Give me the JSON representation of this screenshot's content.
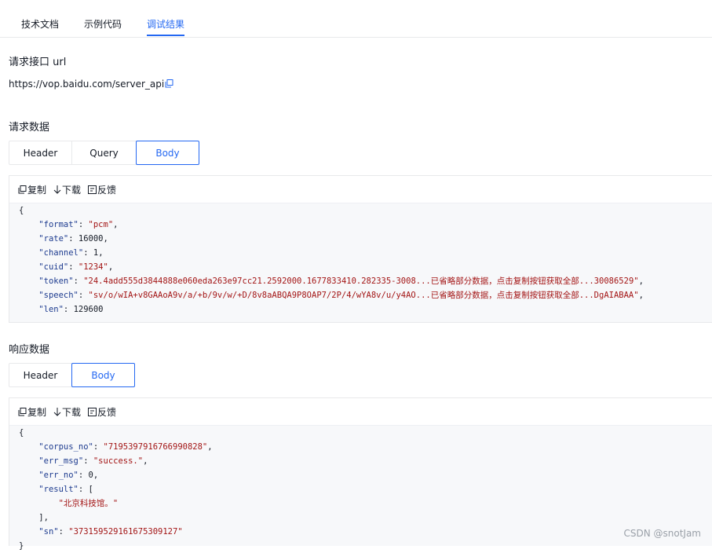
{
  "tabs": [
    {
      "label": "技术文档",
      "active": false
    },
    {
      "label": "示例代码",
      "active": false
    },
    {
      "label": "调试结果",
      "active": true
    }
  ],
  "endpoint": {
    "heading": "请求接口 url",
    "url": "https://vop.baidu.com/server_api"
  },
  "request": {
    "heading": "请求数据",
    "segments": [
      "Header",
      "Query",
      "Body"
    ],
    "active_segment": "Body",
    "toolbar": {
      "copy": "复制",
      "download": "下载",
      "feedback": "反馈"
    },
    "lines": [
      {
        "open": "{"
      },
      {
        "key": "\"format\"",
        "value": "\"pcm\"",
        "type": "string",
        "comma": true
      },
      {
        "key": "\"rate\"",
        "value": "16000",
        "type": "number",
        "comma": true
      },
      {
        "key": "\"channel\"",
        "value": "1",
        "type": "number",
        "comma": true
      },
      {
        "key": "\"cuid\"",
        "value": "\"1234\"",
        "type": "string",
        "comma": true
      },
      {
        "key": "\"token\"",
        "value": "\"24.4add555d3844888e060eda263e97cc21.2592000.1677833410.282335-3008...已省略部分数据，点击复制按钮获取全部...30086529\"",
        "type": "string",
        "comma": true
      },
      {
        "key": "\"speech\"",
        "value": "\"sv/o/wIA+v8GAAoA9v/a/+b/9v/w/+D/8v8aABQA9P8OAP7/2P/4/wYA8v/u/y4AO...已省略部分数据，点击复制按钮获取全部...DgAIABAA\"",
        "type": "string",
        "comma": true
      },
      {
        "key": "\"len\"",
        "value": "129600",
        "type": "number",
        "comma": false
      }
    ]
  },
  "response": {
    "heading": "响应数据",
    "segments": [
      "Header",
      "Body"
    ],
    "active_segment": "Body",
    "toolbar": {
      "copy": "复制",
      "download": "下载",
      "feedback": "反馈"
    },
    "lines": [
      {
        "open": "{"
      },
      {
        "key": "\"corpus_no\"",
        "value": "\"7195397916766990828\"",
        "type": "string",
        "comma": true
      },
      {
        "key": "\"err_msg\"",
        "value": "\"success.\"",
        "type": "string",
        "comma": true
      },
      {
        "key": "\"err_no\"",
        "value": "0",
        "type": "number",
        "comma": true
      },
      {
        "key": "\"result\"",
        "value": "[",
        "type": "punct",
        "comma": false
      },
      {
        "indent2": "\"北京科技馆。\""
      },
      {
        "close_inner": "],"
      },
      {
        "key": "\"sn\"",
        "value": "\"373159529161675309127\"",
        "type": "string",
        "comma": false
      },
      {
        "open": "}"
      }
    ]
  },
  "watermark": "CSDN @snotJam",
  "colors": {
    "accent": "#2468f2",
    "string": "#a31515",
    "key": "#1d3b8f"
  }
}
